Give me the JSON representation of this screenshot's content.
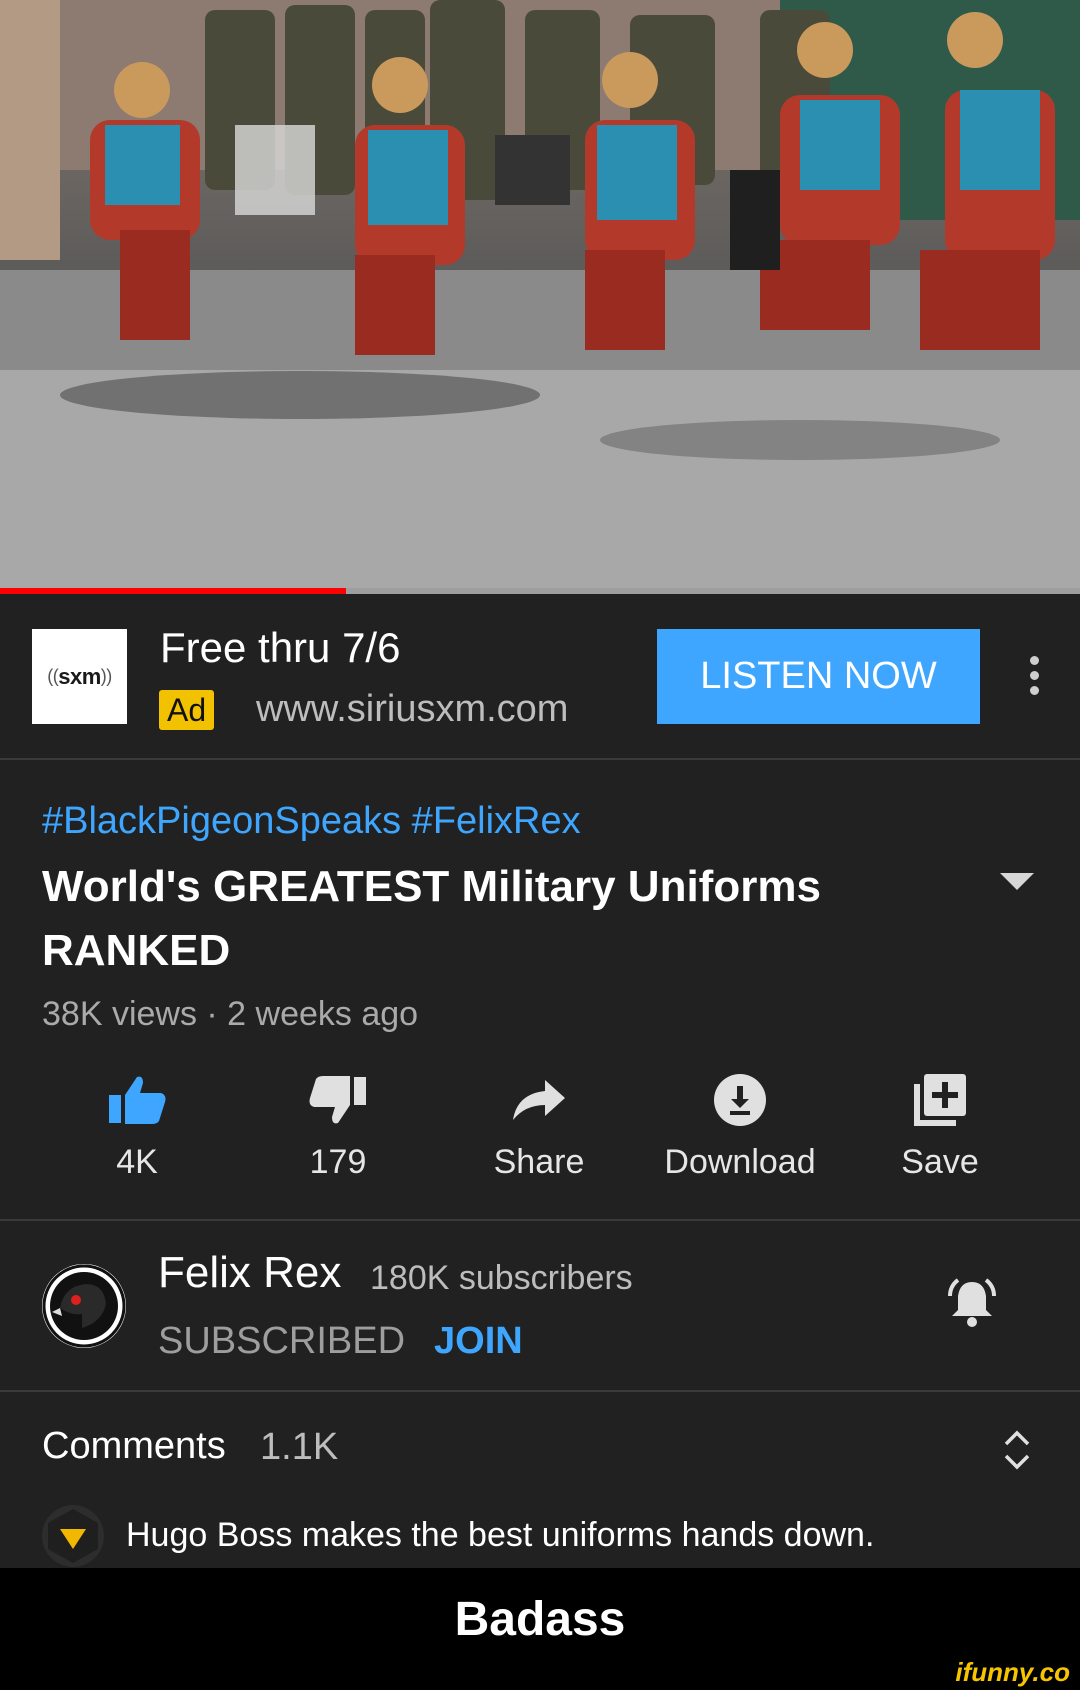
{
  "video": {
    "progress_fraction": 0.32
  },
  "ad": {
    "logo_text": "sxm",
    "title": "Free thru 7/6",
    "badge": "Ad",
    "url": "www.siriusxm.com",
    "cta": "LISTEN NOW"
  },
  "video_info": {
    "hashtags": "#BlackPigeonSpeaks #FelixRex",
    "title": "World's GREATEST Military Uniforms RANKED",
    "meta": "38K views · 2 weeks ago"
  },
  "actions": {
    "like": "4K",
    "dislike": "179",
    "share": "Share",
    "download": "Download",
    "save": "Save"
  },
  "channel": {
    "name": "Felix Rex",
    "subscribers": "180K subscribers",
    "subscribed_label": "SUBSCRIBED",
    "join_label": "JOIN"
  },
  "comments": {
    "label": "Comments",
    "count": "1.1K",
    "top_comment": "Hugo Boss makes the best uniforms hands down."
  },
  "caption": {
    "text": "Badass",
    "watermark": "ifunny.co"
  },
  "colors": {
    "accent_blue": "#3ea6ff",
    "progress_red": "#ff0000",
    "ad_badge_yellow": "#f2c200",
    "background": "#212121"
  }
}
